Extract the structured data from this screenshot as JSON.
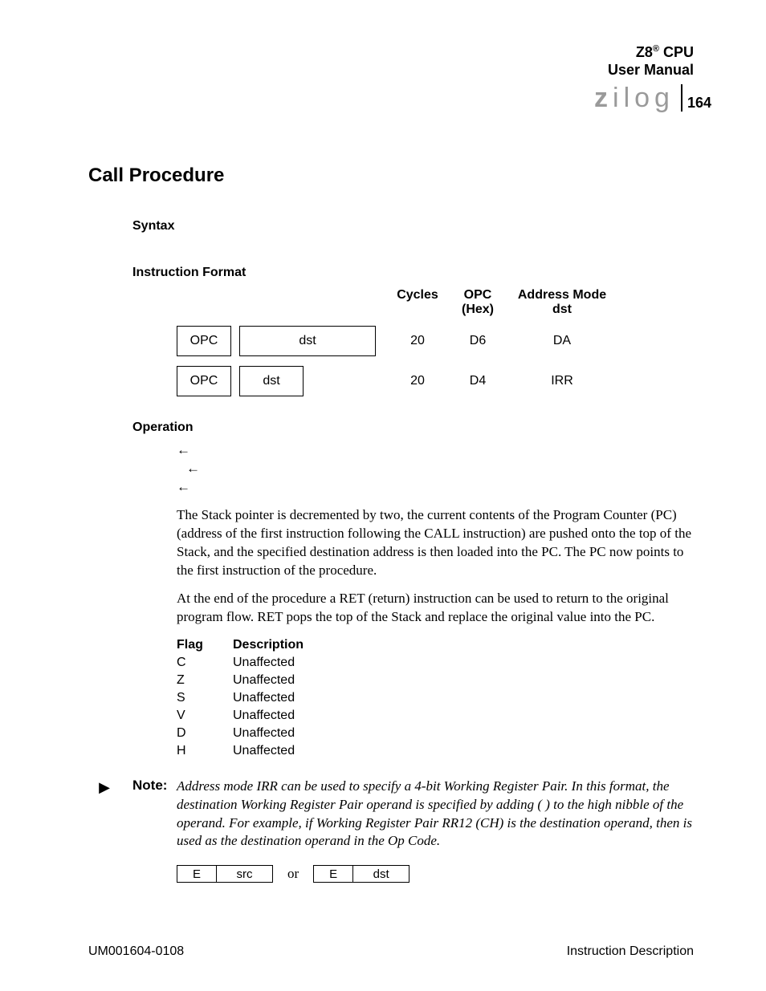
{
  "header": {
    "line1": "Z8",
    "reg": "®",
    "line1b": " CPU",
    "line2": "User Manual",
    "logo": "zilog",
    "page": "164"
  },
  "title": "Call Procedure",
  "labels": {
    "syntax": "Syntax",
    "iformat": "Instruction Format",
    "operation": "Operation"
  },
  "iformat": {
    "head": {
      "cycles": "Cycles",
      "opc": "OPC (Hex)",
      "adm": "Address Mode dst"
    },
    "rows": [
      {
        "opc_box": "OPC",
        "dst_box": "dst",
        "wide": true,
        "cycles": "20",
        "opc": "D6",
        "adm": "DA"
      },
      {
        "opc_box": "OPC",
        "dst_box": "dst",
        "wide": false,
        "cycles": "20",
        "opc": "D4",
        "adm": "IRR"
      }
    ]
  },
  "op_arrows": [
    "←",
    "←",
    "←"
  ],
  "para1": "The Stack pointer is decremented by two, the current contents of the Program Counter (PC) (address of the first instruction following the CALL instruction) are pushed onto the top of the Stack, and the specified destination address is then loaded into the PC. The PC now points to the first instruction of the procedure.",
  "para2": "At the end of the procedure a RET (return) instruction can be used to return to the original program flow. RET pops the top of the Stack and replace the original value into the PC.",
  "flags": {
    "head": {
      "c1": "Flag",
      "c2": "Description"
    },
    "rows": [
      {
        "f": "C",
        "d": "Unaffected"
      },
      {
        "f": "Z",
        "d": "Unaffected"
      },
      {
        "f": "S",
        "d": "Unaffected"
      },
      {
        "f": "V",
        "d": "Unaffected"
      },
      {
        "f": "D",
        "d": "Unaffected"
      },
      {
        "f": "H",
        "d": "Unaffected"
      }
    ]
  },
  "note": {
    "label": "Note:",
    "text": "Address mode IRR can be used to specify a 4-bit Working Register Pair. In this format, the destination Working Register Pair operand is specified by adding          (    ) to the high nibble of the operand. For example, if Working Register Pair RR12 (CH) is the destination operand, then        is used as the destination operand in the Op Code."
  },
  "esrc": {
    "e": "E",
    "src": "src",
    "or": "or",
    "dst": "dst"
  },
  "footer": {
    "left": "UM001604-0108",
    "right": "Instruction Description"
  }
}
